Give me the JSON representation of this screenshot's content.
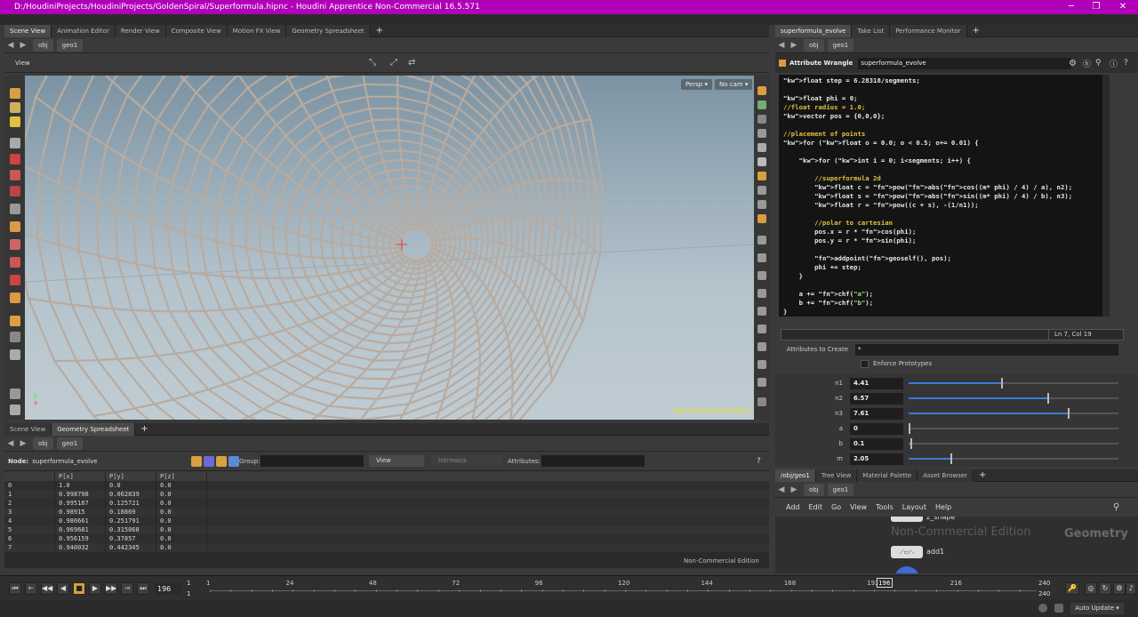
{
  "window": {
    "title": "D:/HoudiniProjects/HoudiniProjects/GoldenSpiral/Superformula.hipnc - Houdini Apprentice Non-Commercial 16.5.571"
  },
  "top_left_tabs": [
    "Scene View",
    "Animation Editor",
    "Render View",
    "Composite View",
    "Motion FX View",
    "Geometry Spreadsheet"
  ],
  "path": {
    "root": "obj",
    "node": "geo1"
  },
  "viewport": {
    "label": "View",
    "persp_label": "Persp",
    "cam_label": "No cam",
    "watermark": "Non-Commercial Edition"
  },
  "bottom_left_tabs": [
    "Scene View",
    "Geometry Spreadsheet"
  ],
  "spreadsheet": {
    "node_label": "Node:",
    "node_name": "superformula_evolve",
    "group_label": "Group:",
    "view_label": "View",
    "intrinsics_label": "Intrinsics",
    "attributes_label": "Attributes:",
    "columns": [
      "",
      "P[x]",
      "P[y]",
      "P[z]"
    ],
    "rows": [
      [
        "0",
        "1.0",
        "0.0",
        "0.0"
      ],
      [
        "1",
        "0.998798",
        "0.062839",
        "0.0"
      ],
      [
        "2",
        "0.995187",
        "0.125721",
        "0.0"
      ],
      [
        "3",
        "0.98915",
        "0.18869",
        "0.0"
      ],
      [
        "4",
        "0.980661",
        "0.251791",
        "0.0"
      ],
      [
        "5",
        "0.969681",
        "0.315068",
        "0.0"
      ],
      [
        "6",
        "0.956159",
        "0.37857",
        "0.0"
      ],
      [
        "7",
        "0.940032",
        "0.442345",
        "0.0"
      ]
    ],
    "watermark": "Non-Commercial Edition"
  },
  "right_tabs": [
    "superformula_evolve",
    "Take List",
    "Performance Monitor"
  ],
  "wrangle": {
    "type_label": "Attribute Wrangle",
    "node_name": "superformula_evolve",
    "code_lines": [
      "float step = 6.28318/segments;",
      "",
      "float phi = 0;",
      "//float radius = 1.0;",
      "vector pos = {0,0,0};",
      "",
      "//placement of points",
      "for (float o = 0.0; o < 0.5; o+= 0.01) {",
      "",
      "    for (int i = 0; i<segments; i++) {",
      "",
      "        //superformula 2d",
      "        float c = pow(abs(cos((m* phi) / 4) / a), n2);",
      "        float s = pow(abs(sin((m* phi) / 4) / b), n3);",
      "        float r = pow((c + s), -(1/n1));",
      "",
      "        //polar to cartesian",
      "        pos.x = r * cos(phi);",
      "        pos.y = r * sin(phi);",
      "",
      "        addpoint(geoself(), pos);",
      "        phi += step;",
      "    }",
      "",
      "    a += chf(\"a\");",
      "    b += chf(\"b\");",
      "}"
    ],
    "cursor_pos": "Ln 7, Col 19",
    "attributes_to_create_label": "Attributes to Create",
    "attributes_to_create_value": "*",
    "enforce_prototypes_label": "Enforce Prototypes"
  },
  "params": [
    {
      "name": "n1",
      "value": "4.41",
      "fraction": 0.44
    },
    {
      "name": "n2",
      "value": "6.57",
      "fraction": 0.66
    },
    {
      "name": "n3",
      "value": "7.61",
      "fraction": 0.76
    },
    {
      "name": "a",
      "value": "0",
      "fraction": 0.0
    },
    {
      "name": "b",
      "value": "0.1",
      "fraction": 0.01
    },
    {
      "name": "m",
      "value": "2.05",
      "fraction": 0.2
    }
  ],
  "network_tabs": [
    "/obj/geo1",
    "Tree View",
    "Material Palette",
    "Asset Browser"
  ],
  "network_menu": [
    "Add",
    "Edit",
    "Go",
    "View",
    "Tools",
    "Layout",
    "Help"
  ],
  "network": {
    "node_top_label": "z_shape",
    "node_add_label": "add1",
    "watermark": "Non-Commercial Edition",
    "context_label": "Geometry"
  },
  "timeline": {
    "current_frame": "196",
    "start_top": "1",
    "start_bottom": "1",
    "ticks": [
      "1",
      "24",
      "48",
      "72",
      "96",
      "120",
      "144",
      "168",
      "192",
      "216"
    ],
    "end_top": "240",
    "end_bottom": "240",
    "playhead": "196"
  },
  "status": {
    "auto_update": "Auto Update"
  }
}
